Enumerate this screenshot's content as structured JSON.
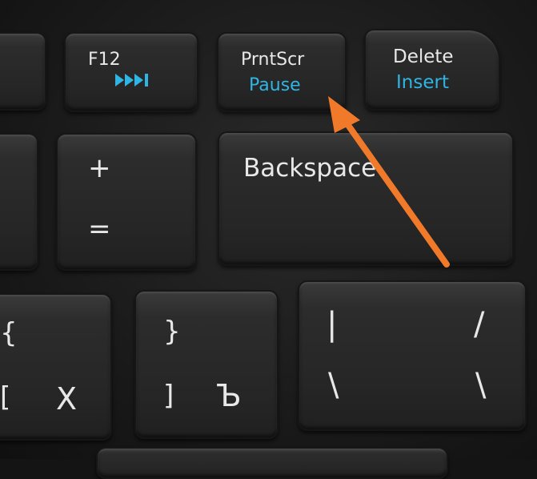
{
  "keys": {
    "f12": {
      "label": "F12",
      "icon": "fast-forward-icon",
      "icon_color": "#2fb4e4"
    },
    "prntscr": {
      "primary": "PrntScr",
      "secondary": "Pause",
      "secondary_color": "#2fb4e4"
    },
    "delete": {
      "primary": "Delete",
      "secondary": "Insert",
      "secondary_color": "#2fb4e4"
    },
    "plus_equals": {
      "top": "+",
      "bottom": "="
    },
    "backspace": {
      "label": "Backspace"
    },
    "brace_left": {
      "top": "{",
      "bottom": "[",
      "cyrillic": "Х"
    },
    "brace_right": {
      "top": "}",
      "bottom": "]",
      "cyrillic": "Ъ"
    },
    "slash": {
      "top_left": "|",
      "top_right": "/",
      "bottom_left": "\\",
      "bottom_right": "\\"
    }
  },
  "annotation": {
    "type": "arrow",
    "color": "#f07a2a",
    "points_to": "prntscr"
  }
}
